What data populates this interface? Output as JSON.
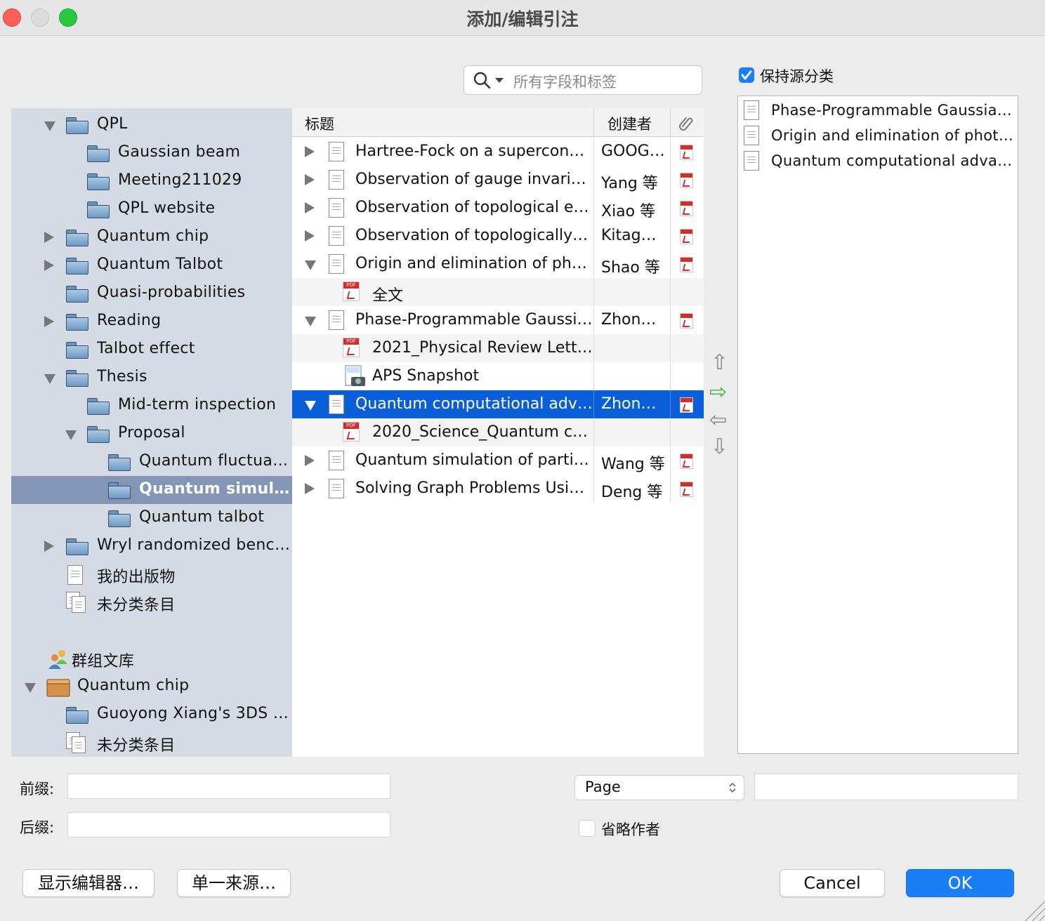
{
  "window": {
    "title": "添加/编辑引注",
    "traffic_colors": {
      "close": "#fe5f57",
      "minimize": "#dcdcdc",
      "zoom": "#28c840"
    }
  },
  "search": {
    "placeholder": "所有字段和标签"
  },
  "keep_source": {
    "label": "保持源分类",
    "checked": true
  },
  "tree": [
    {
      "label": "QPL",
      "toggle": "down",
      "icon": "folder"
    },
    {
      "label": "Gaussian beam",
      "toggle": "none",
      "icon": "folder"
    },
    {
      "label": "Meeting211029",
      "toggle": "none",
      "icon": "folder"
    },
    {
      "label": "QPL website",
      "toggle": "none",
      "icon": "folder"
    },
    {
      "label": "Quantum chip",
      "toggle": "right",
      "icon": "folder"
    },
    {
      "label": "Quantum Talbot",
      "toggle": "right",
      "icon": "folder"
    },
    {
      "label": "Quasi-probabilities",
      "toggle": "none",
      "icon": "folder"
    },
    {
      "label": "Reading",
      "toggle": "right",
      "icon": "folder"
    },
    {
      "label": "Talbot effect",
      "toggle": "none",
      "icon": "folder"
    },
    {
      "label": "Thesis",
      "toggle": "down",
      "icon": "folder"
    },
    {
      "label": "Mid-term inspection",
      "toggle": "none",
      "icon": "folder"
    },
    {
      "label": "Proposal",
      "toggle": "down",
      "icon": "folder"
    },
    {
      "label": "Quantum fluctua…",
      "toggle": "none",
      "icon": "folder"
    },
    {
      "label": "Quantum simul…",
      "toggle": "none",
      "icon": "folder",
      "selected": true
    },
    {
      "label": "Quantum talbot",
      "toggle": "none",
      "icon": "folder"
    },
    {
      "label": "Wryl randomized benc…",
      "toggle": "right",
      "icon": "folder"
    },
    {
      "label": "我的出版物",
      "toggle": "none",
      "icon": "document"
    },
    {
      "label": "未分类条目",
      "toggle": "none",
      "icon": "documents"
    },
    {
      "label": "群组文库",
      "toggle": "none",
      "icon": "group"
    },
    {
      "label": "Quantum chip",
      "toggle": "down",
      "icon": "library"
    },
    {
      "label": "Guoyong Xiang's 3DS …",
      "toggle": "none",
      "icon": "folder"
    },
    {
      "label": "未分类条目",
      "toggle": "none",
      "icon": "documents"
    }
  ],
  "list": {
    "columns": {
      "title": "标题",
      "creator": "创建者"
    },
    "rows": [
      {
        "title": "Hartree-Fock on a supercon…",
        "creator": "GOOG…",
        "toggle": "right",
        "pdf": true
      },
      {
        "title": "Observation of gauge invari…",
        "creator": "Yang 等",
        "toggle": "right",
        "pdf": true
      },
      {
        "title": "Observation of topological e…",
        "creator": "Xiao 等",
        "toggle": "right",
        "pdf": true
      },
      {
        "title": "Observation of topologically…",
        "creator": "Kitag…",
        "toggle": "right",
        "pdf": true
      },
      {
        "title": "Origin and elimination of ph…",
        "creator": "Shao 等",
        "toggle": "down",
        "pdf": true
      },
      {
        "title": "全文",
        "creator": "",
        "child": "pdf"
      },
      {
        "title": "Phase-Programmable Gaussi…",
        "creator": "Zhon…",
        "toggle": "down",
        "pdf": true
      },
      {
        "title": "2021_Physical Review Lett…",
        "creator": "",
        "child": "pdf"
      },
      {
        "title": "APS Snapshot",
        "creator": "",
        "child": "snapshot"
      },
      {
        "title": "Quantum computational adv…",
        "creator": "Zhon…",
        "toggle": "down",
        "pdf": true,
        "selected": true
      },
      {
        "title": "2020_Science_Quantum c…",
        "creator": "",
        "child": "pdf"
      },
      {
        "title": "Quantum simulation of parti…",
        "creator": "Wang 等",
        "toggle": "right",
        "pdf": true
      },
      {
        "title": "Solving Graph Problems Usi…",
        "creator": "Deng 等",
        "toggle": "right",
        "pdf": true
      }
    ]
  },
  "arrows": {
    "up": "⇧",
    "right": "⇨",
    "left": "⇦",
    "down": "⇩",
    "right_color": "#3dbb3d"
  },
  "selected_items": [
    "Phase-Programmable Gaussia…",
    "Origin and elimination of phot…",
    "Quantum computational adva…"
  ],
  "form": {
    "prefix_label": "前缀:",
    "suffix_label": "后缀:",
    "prefix_value": "",
    "suffix_value": "",
    "locator_value": "",
    "locator_type": "Page",
    "omit_author_label": "省略作者",
    "omit_author_checked": false
  },
  "buttons": {
    "show_editor": "显示编辑器…",
    "single_source": "单一来源…",
    "cancel": "Cancel",
    "ok": "OK"
  }
}
